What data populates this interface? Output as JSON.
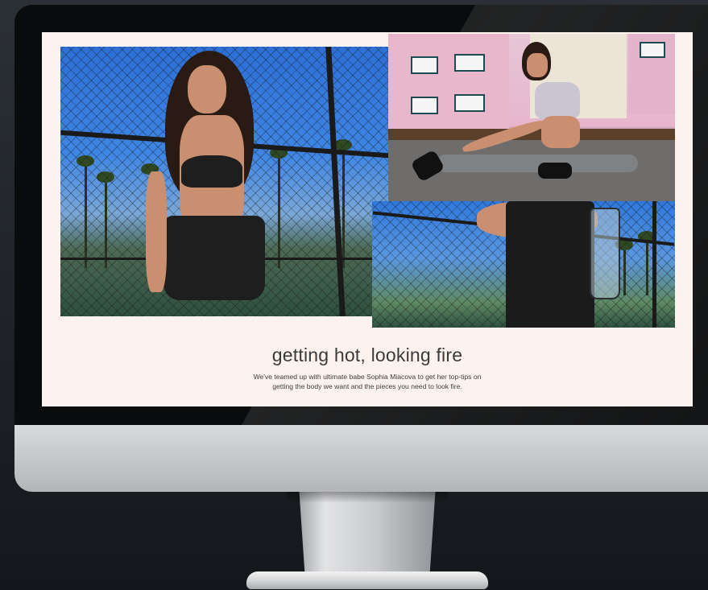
{
  "hero": {
    "headline": "getting hot, looking fire",
    "subtext": "We've teamed up with ultimate babe Sophia Miacova to get her top-tips on getting the body we want and the pieces you need to look fire."
  },
  "colors": {
    "page_background": "#fdf2ee",
    "headline_text": "#3a3a3a",
    "desktop_background": "#1f2328"
  },
  "images": [
    {
      "name": "model-leather-set-tennis-court"
    },
    {
      "name": "model-stretching-sports-bra"
    },
    {
      "name": "model-holding-shaker-bottle"
    }
  ]
}
